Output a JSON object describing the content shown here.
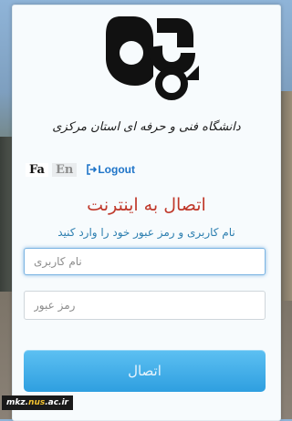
{
  "logo": {
    "caption": "دانشگاه فنی و حرفه ای استان مرکزی"
  },
  "lang": {
    "fa": "Fa",
    "en": "En",
    "logout": "Logout",
    "logout_icon": "logout-icon"
  },
  "form": {
    "title": "اتصال به اینترنت",
    "subtitle": "نام کاربری و رمز عبور خود را وارد کنید",
    "username_placeholder": "نام کاربری",
    "password_placeholder": "رمز عبور",
    "submit_label": "اتصال"
  },
  "watermark": {
    "prefix": "mkz.",
    "accent": "nus",
    "suffix": ".ac.ir"
  },
  "colors": {
    "title": "#c0392b",
    "subtitle": "#2d7fb0",
    "button": "#2f9fe0",
    "link": "#1e74c8"
  }
}
